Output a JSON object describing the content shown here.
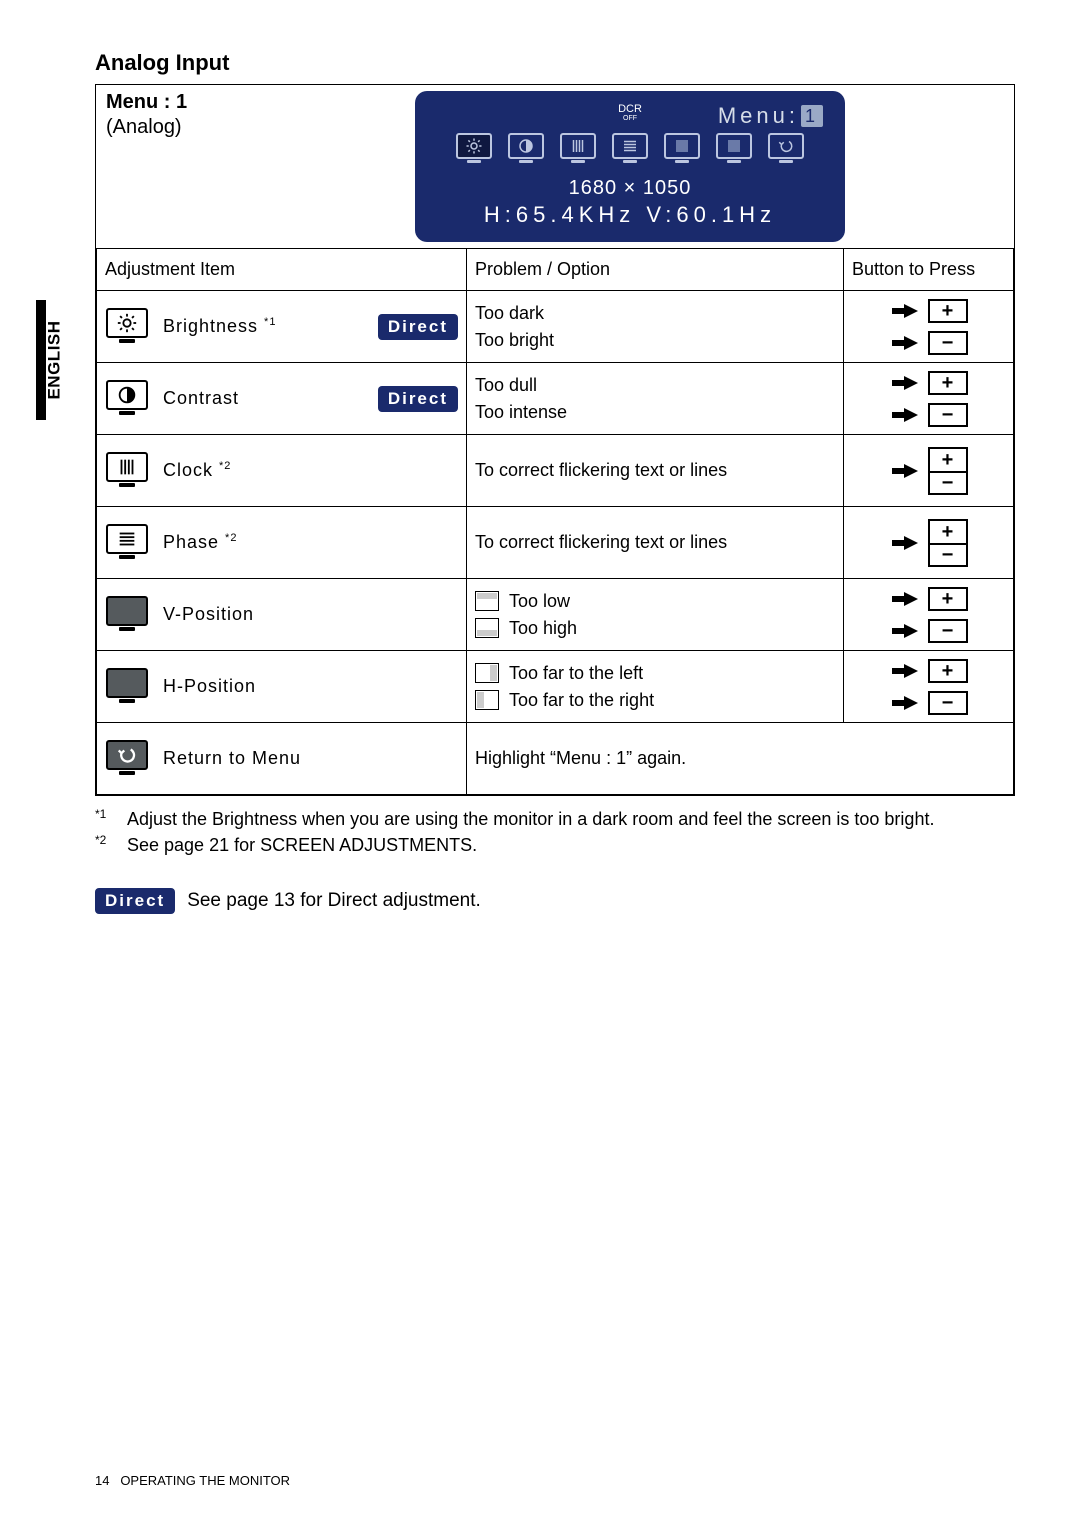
{
  "sideTab": "ENGLISH",
  "title": "Analog Input",
  "menuLabel": "Menu : 1",
  "analogLabel": "(Analog)",
  "osd": {
    "dcr": "DCR",
    "dcrOff": "OFF",
    "menuWord": "Menu:",
    "menuNum": "1",
    "resolution": "1680 × 1050",
    "freq": "H:65.4KHz  V:60.1Hz"
  },
  "headers": {
    "item": "Adjustment Item",
    "problem": "Problem / Option",
    "button": "Button to Press"
  },
  "directBadge": "Direct",
  "rows": {
    "brightness": {
      "label": "Brightness ",
      "sup": "*1",
      "p1": "Too dark",
      "p2": "Too bright"
    },
    "contrast": {
      "label": "Contrast",
      "p1": "Too dull",
      "p2": "Too intense"
    },
    "clock": {
      "label": "Clock ",
      "sup": "*2",
      "p1": "To correct flickering text or lines"
    },
    "phase": {
      "label": "Phase ",
      "sup": "*2",
      "p1": "To correct flickering text or lines"
    },
    "vpos": {
      "label": "V-Position",
      "p1": "Too low",
      "p2": "Too high"
    },
    "hpos": {
      "label": "H-Position",
      "p1": "Too far to the left",
      "p2": "Too far to the right"
    },
    "return": {
      "label": "Return to Menu",
      "p1": "Highlight “Menu : 1” again."
    }
  },
  "footnotes": {
    "f1m": "*1",
    "f1": "Adjust the Brightness when you are using the monitor in a dark room and feel the screen is too bright.",
    "f2m": "*2",
    "f2": "See page 21 for SCREEN ADJUSTMENTS."
  },
  "directNote": "See page 13 for Direct adjustment.",
  "footer": {
    "page": "14",
    "section": "OPERATING THE MONITOR"
  }
}
